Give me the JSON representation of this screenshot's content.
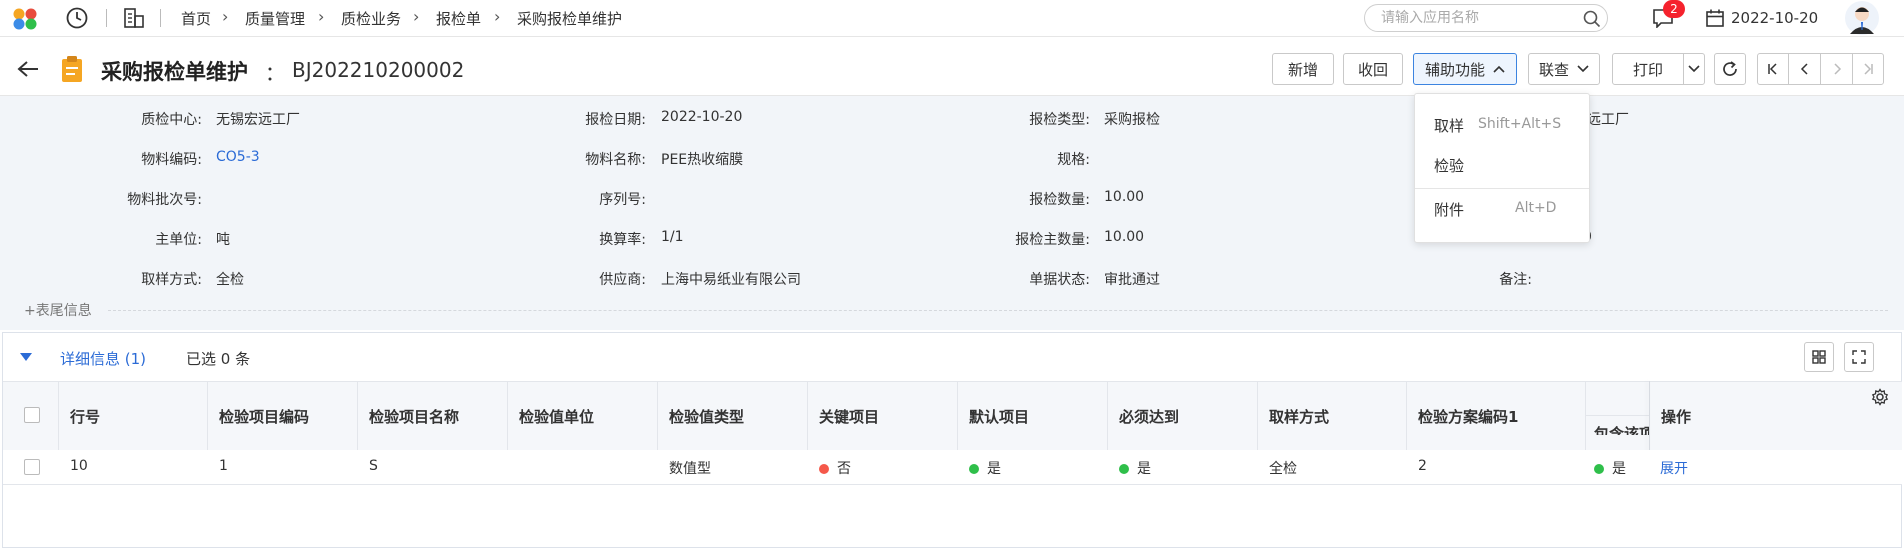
{
  "topbar": {
    "breadcrumbs": [
      "首页",
      "质量管理",
      "质检业务",
      "报检单",
      "采购报检单维护"
    ],
    "search_placeholder": "请输入应用名称",
    "notification_count": "2",
    "date": "2022-10-20"
  },
  "titlebar": {
    "title": "采购报检单维护",
    "colon": "：",
    "doc_no": "BJ202210200002",
    "buttons": {
      "new": "新增",
      "recall": "收回",
      "aux": "辅助功能",
      "link": "联查",
      "print": "打印"
    }
  },
  "aux_menu": {
    "items": [
      {
        "label": "取样",
        "shortcut": "Shift+Alt+S"
      },
      {
        "label": "检验",
        "shortcut": ""
      },
      {
        "label": "附件",
        "shortcut": "Alt+D"
      }
    ]
  },
  "form": {
    "col1": [
      {
        "label": "质检中心:",
        "value": "无锡宏远工厂"
      },
      {
        "label": "物料编码:",
        "value": "CO5-3"
      },
      {
        "label": "物料批次号:",
        "value": ""
      },
      {
        "label": "主单位:",
        "value": "吨"
      },
      {
        "label": "取样方式:",
        "value": "全检"
      }
    ],
    "col2": [
      {
        "label": "报检日期:",
        "value": "2022-10-20"
      },
      {
        "label": "物料名称:",
        "value": "PEE热收缩膜"
      },
      {
        "label": "序列号:",
        "value": ""
      },
      {
        "label": "换算率:",
        "value": "1/1"
      },
      {
        "label": "供应商:",
        "value": "上海中易纸业有限公司"
      }
    ],
    "col3": [
      {
        "label": "报检类型:",
        "value": "采购报检"
      },
      {
        "label": "规格:",
        "value": ""
      },
      {
        "label": "报检数量:",
        "value": "10.00"
      },
      {
        "label": "报检主数量:",
        "value": "10.00"
      },
      {
        "label": "单据状态:",
        "value": "审批通过"
      }
    ],
    "col4_partial": {
      "row1_value": "宏远工厂",
      "row4_value": "0",
      "remark_label": "备注:"
    },
    "footer_toggle": "+表尾信息"
  },
  "grid": {
    "tab_label": "详细信息 (1)",
    "selected_text": "已选 0 条",
    "headers": [
      "行号",
      "检验项目编码",
      "检验项目名称",
      "检验值单位",
      "检验值类型",
      "关键项目",
      "默认项目",
      "必须达到",
      "取样方式",
      "检验方案编码1",
      "包含该项",
      "操作"
    ],
    "rows": [
      {
        "line_no": "10",
        "item_code": "1",
        "item_name": "S",
        "unit": "",
        "value_type": "数值型",
        "key_item": "否",
        "default_item": "是",
        "must_reach": "是",
        "sampling": "全检",
        "plan_code": "2",
        "include": "是",
        "action": "展开"
      }
    ]
  },
  "colors": {
    "red_dot": "#f5584a",
    "green_dot": "#2fbf4a",
    "link": "#2b6bd6",
    "badge": "#f5222d",
    "title_icon": "#f5a623"
  }
}
